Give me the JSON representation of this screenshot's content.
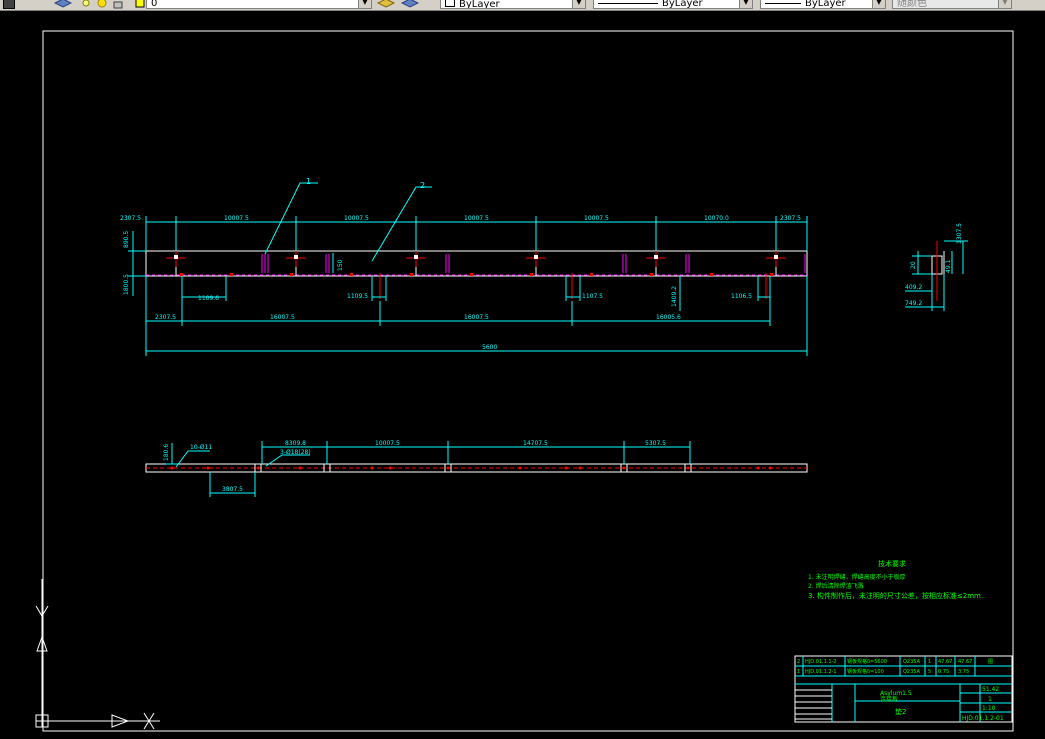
{
  "toolbar": {
    "layer_value": "0",
    "color_value": "ByLayer",
    "linetype_value": "ByLayer",
    "lineweight_value": "ByLayer",
    "plotstyle_value": "随颜色"
  },
  "colors": {
    "background": "#000000",
    "dim": "#00ffff",
    "geometry": "#ffffff",
    "hidden": "#ff0000",
    "magenta": "#ff00ff",
    "notes": "#00ff00",
    "border": "#ffffff",
    "ucs": "#ffffff"
  },
  "drawing": {
    "leaders": [
      "1",
      "2"
    ],
    "top_dims": [
      "2307.5",
      "10007.5",
      "10007.5",
      "10007.5",
      "10007.5",
      "10070.0",
      "2307.5"
    ],
    "left_dims": [
      "890.5",
      "1800.5"
    ],
    "hole_dims": [
      "1109.6",
      "1109.5",
      "1107.5",
      "1106.5",
      "1409.2"
    ],
    "mid_label": "150",
    "bottom_dims": [
      "2307.5",
      "16007.5",
      "16007.5",
      "16005.6"
    ],
    "overall": "5600",
    "side_view": {
      "dims": [
        "1307.5",
        "49.1",
        "20",
        "409.2",
        "749.2"
      ]
    },
    "strip": {
      "label1": "10-Ø11",
      "label2": "3-Ø18(28)",
      "height_dim": "180.6",
      "top_dims": [
        "8309.8",
        "10007.5",
        "14707.5",
        "5307.5"
      ],
      "bottom_dim": "3807.5"
    }
  },
  "notes": {
    "title": "技术要求",
    "lines": [
      "1.  未注明焊缝，焊缝高度不小于板厚",
      "2.  焊后清除焊渣飞溅",
      "3.  构件制作后，未注明的尺寸公差，按相应标准≤2mm."
    ]
  },
  "titleblock": {
    "bom": [
      {
        "no": "2",
        "code": "HJD.01.1.1-2",
        "name": "钢板规格δ=5600",
        "mat": "Q235A",
        "qty": "1",
        "unit": "47.67",
        "total": "47.67",
        "remark": "图"
      },
      {
        "no": "1",
        "code": "HJD.01.1.2-1",
        "name": "钢板规格δ=100",
        "mat": "Q235A",
        "qty": "5",
        "unit": "0.75",
        "total": "3.75",
        "remark": ""
      }
    ],
    "product": "Asylum1.5",
    "part_name": "连接板",
    "part_sub": "垫2",
    "weight": "51.42",
    "count": "1",
    "scale": "1:10",
    "drawing_no": "HJD.01.1.2-01"
  }
}
